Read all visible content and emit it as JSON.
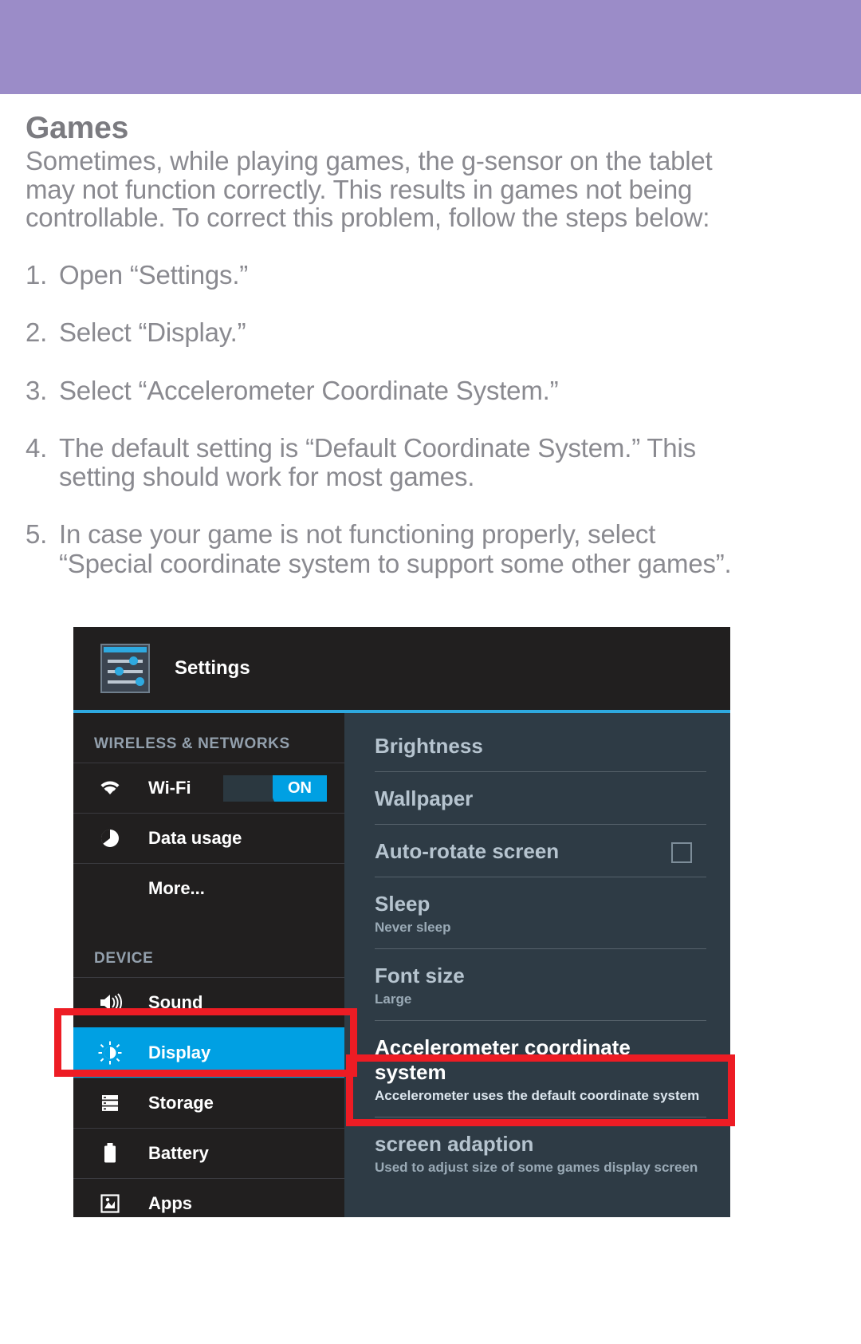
{
  "document": {
    "title": "Games",
    "intro_lines": [
      "Sometimes, while playing games, the g-sensor on the tablet",
      "may not function correctly. This results in games not being",
      "controllable. To correct this problem, follow the steps below:"
    ],
    "steps": [
      {
        "num": "1.",
        "lines": [
          "Open “Settings.”"
        ]
      },
      {
        "num": "2.",
        "lines": [
          "Select “Display.”"
        ]
      },
      {
        "num": "3.",
        "lines": [
          "Select “Accelerometer Coordinate System.”"
        ]
      },
      {
        "num": "4.",
        "lines": [
          "The default setting is “Default Coordinate System.” This",
          "setting should work for most games."
        ]
      },
      {
        "num": "5.",
        "lines": [
          "In case your game is not functioning properly, select",
          "“Special coordinate system to support some other games”."
        ]
      }
    ]
  },
  "screenshot": {
    "header": {
      "app_title": "Settings",
      "icon": "settings-sliders-icon"
    },
    "sidebar": {
      "groups": [
        {
          "label": "WIRELESS & NETWORKS",
          "items": [
            {
              "label": "Wi-Fi",
              "icon": "wifi-icon",
              "toggle": "ON",
              "selected": false
            },
            {
              "label": "Data usage",
              "icon": "data-usage-icon",
              "selected": false
            },
            {
              "label": "More...",
              "icon": null,
              "selected": false
            }
          ]
        },
        {
          "label": "DEVICE",
          "items": [
            {
              "label": "Sound",
              "icon": "speaker-icon",
              "selected": false
            },
            {
              "label": "Display",
              "icon": "brightness-icon",
              "selected": true
            },
            {
              "label": "Storage",
              "icon": "storage-icon",
              "selected": false
            },
            {
              "label": "Battery",
              "icon": "battery-icon",
              "selected": false
            },
            {
              "label": "Apps",
              "icon": "apps-icon",
              "selected": false
            }
          ]
        }
      ]
    },
    "pane": {
      "rows": [
        {
          "title": "Brightness",
          "sub": null,
          "checkbox": false,
          "emphasis": false
        },
        {
          "title": "Wallpaper",
          "sub": null,
          "checkbox": false,
          "emphasis": false
        },
        {
          "title": "Auto-rotate screen",
          "sub": null,
          "checkbox": true,
          "emphasis": false
        },
        {
          "title": "Sleep",
          "sub": "Never sleep",
          "checkbox": false,
          "emphasis": false
        },
        {
          "title": "Font size",
          "sub": "Large",
          "checkbox": false,
          "emphasis": false
        },
        {
          "title": "Accelerometer coordinate system",
          "sub": "Accelerometer uses the default coordinate system",
          "checkbox": false,
          "emphasis": true
        },
        {
          "title": "screen adaption",
          "sub": "Used to adjust size of some games display screen",
          "checkbox": false,
          "emphasis": false
        }
      ]
    },
    "annotations": [
      {
        "name": "highlight-display-row",
        "color": "#ED1C24"
      },
      {
        "name": "highlight-accelerometer-row",
        "color": "#ED1C24"
      }
    ]
  },
  "colors": {
    "band": "#9B8CC8",
    "accent": "#00A0E3",
    "annotation": "#ED1C24",
    "sidebar_bg": "#211F1F",
    "pane_bg": "#2E3B45"
  }
}
